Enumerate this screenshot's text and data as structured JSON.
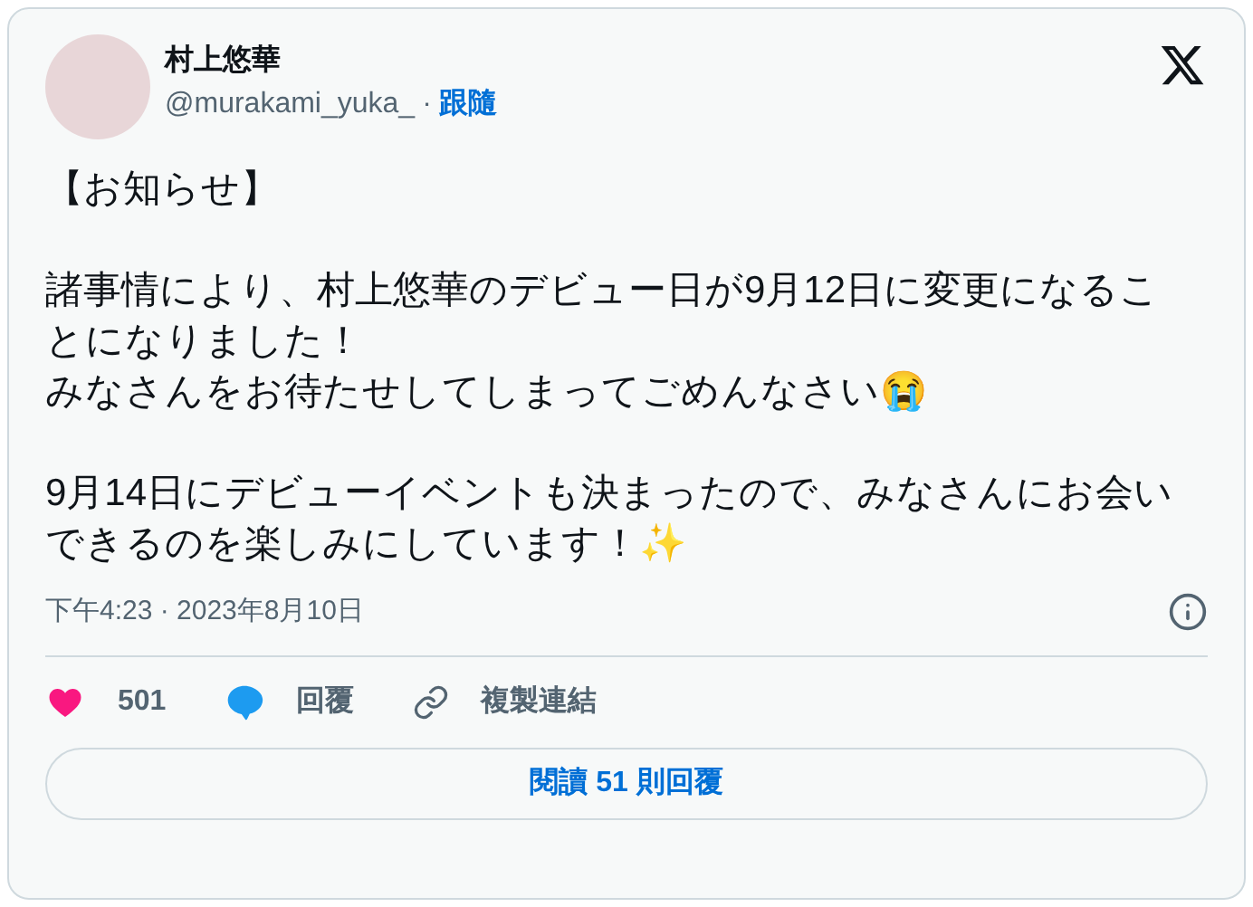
{
  "author": {
    "name": "村上悠華",
    "handle": "@murakami_yuka_",
    "separator": "·",
    "follow": "跟隨"
  },
  "body": [
    [
      "【お知らせ】"
    ],
    [
      "諸事情により、村上悠華のデビュー日が9月12日に変更になることになりました！",
      "みなさんをお待たせしてしまってごめんなさい😭"
    ],
    [
      "9月14日にデビューイベントも決まったので、みなさんにお会いできるのを楽しみにしています！✨"
    ]
  ],
  "timestamp": "下午4:23 · 2023年8月10日",
  "actions": [
    {
      "kind": "like",
      "label": "501"
    },
    {
      "kind": "reply",
      "label": "回覆"
    },
    {
      "kind": "copy",
      "label": "複製連結"
    }
  ],
  "read_replies": "閱讀 51 則回覆"
}
